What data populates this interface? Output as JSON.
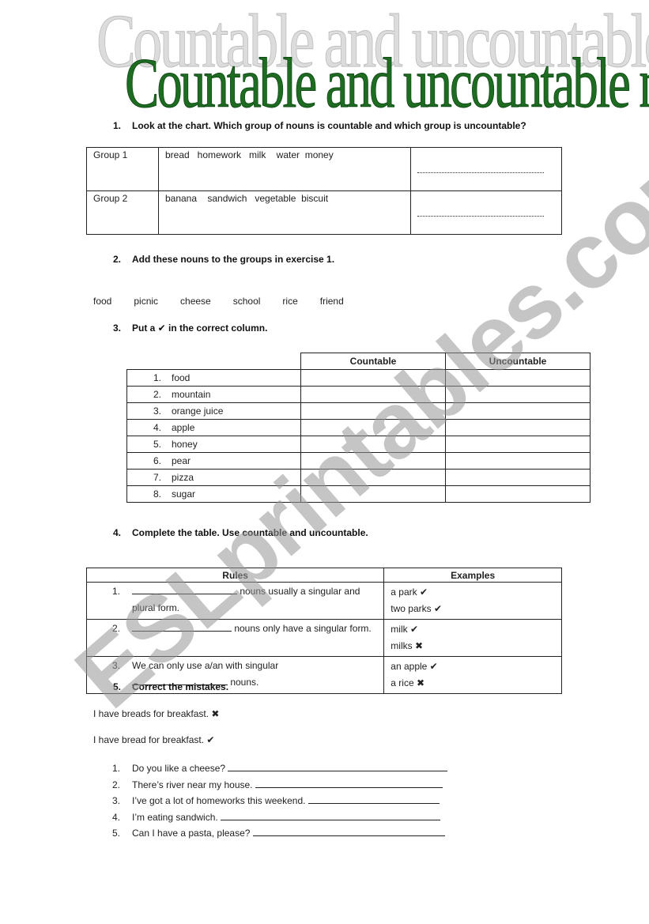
{
  "title": {
    "shadow_text": "Countable and uncountable nouns",
    "main_text": "Countable and uncountable nouns"
  },
  "watermark": "ESLprintables.com",
  "colors": {
    "title_green": "#1e6b22",
    "title_shadow": "#dcdcdc",
    "watermark_gray": "#969696"
  },
  "exercise1": {
    "number": "1.",
    "instruction": "Look at the chart. Which group of nouns is countable and which group is uncountable?",
    "rows": [
      {
        "group": "Group 1",
        "nouns": "bread   homework   milk    water  money",
        "answer": ""
      },
      {
        "group": "Group 2",
        "nouns": "banana    sandwich   vegetable  biscuit",
        "answer": ""
      }
    ]
  },
  "exercise2": {
    "number": "2.",
    "instruction": "Add these nouns to the groups in exercise 1.",
    "words": "food   picnic   cheese   school   rice   friend"
  },
  "exercise3": {
    "number": "3.",
    "instruction": "Put a ✔ in the correct column.",
    "headers": [
      "Countable",
      "Uncountable"
    ],
    "items": [
      {
        "n": "1.",
        "word": "food"
      },
      {
        "n": "2.",
        "word": "mountain"
      },
      {
        "n": "3.",
        "word": "orange juice"
      },
      {
        "n": "4.",
        "word": "apple"
      },
      {
        "n": "5.",
        "word": "honey"
      },
      {
        "n": "6.",
        "word": "pear"
      },
      {
        "n": "7.",
        "word": "pizza"
      },
      {
        "n": "8.",
        "word": "sugar"
      }
    ]
  },
  "exercise4": {
    "number": "4.",
    "instruction": "Complete the table. Use countable and uncountable.",
    "headers": {
      "rules": "Rules",
      "examples": "Examples"
    },
    "rows": [
      {
        "n": "1.",
        "after_blank": " nouns usually a singular and",
        "line2": "plural form.",
        "ex1": "a park ✔",
        "ex2": "two parks ✔"
      },
      {
        "n": "2.",
        "after_blank": " nouns only have a singular form.",
        "line2": "",
        "ex1": "milk ✔",
        "ex2": "milks ✖"
      },
      {
        "n": "3.",
        "line1": "We can only use a/an with singular",
        "after_blank": " nouns.",
        "ex1": "an apple ✔",
        "ex2": "a rice ✖"
      }
    ]
  },
  "exercise5": {
    "number": "5.",
    "instruction": "Correct the mistakes.",
    "wrong_example": "I have breads for breakfast. ✖",
    "right_example": "I have bread for breakfast. ✔",
    "items": [
      {
        "n": "1.",
        "text": "Do you like a cheese? "
      },
      {
        "n": "2.",
        "text": "There’s river near my house. "
      },
      {
        "n": "3.",
        "text": "I’ve got a lot of homeworks this weekend. "
      },
      {
        "n": "4.",
        "text": "I’m eating sandwich. "
      },
      {
        "n": "5.",
        "text": "Can I have a pasta, please? "
      }
    ]
  }
}
